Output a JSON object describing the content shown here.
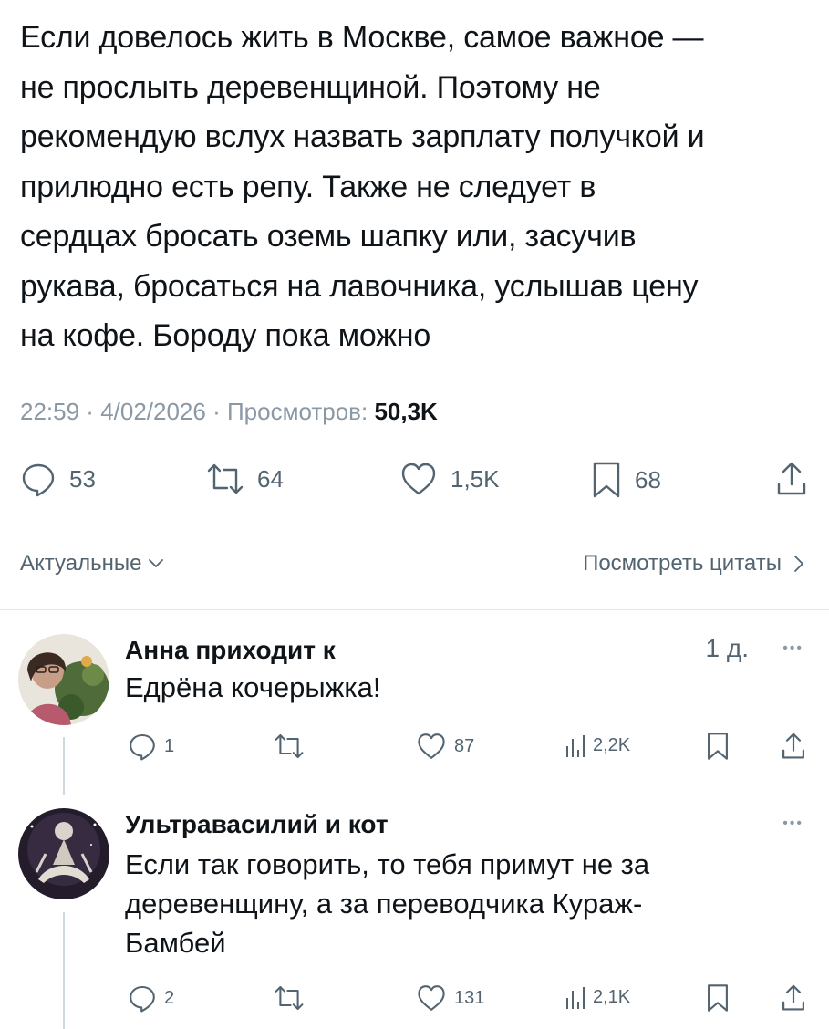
{
  "tweet": {
    "text_lines": [
      "Если довелось жить в Москве, самое важное —",
      "не прослыть деревенщиной. Поэтому не",
      "рекомендую вслух назвать зарплату получкой и",
      "прилюдно есть репу. Также не следует в",
      "сердцах бросать оземь шапку или, засучив",
      "рукава, бросаться на лавочника, услышав цену",
      "на кофе. Бороду пока можно"
    ],
    "time": "22:59",
    "date": "4/02/2026",
    "views_label": "Просмотров:",
    "views": "50,3K",
    "sep": " · ",
    "actions": {
      "replies": "53",
      "reposts": "64",
      "likes": "1,5K",
      "bookmarks": "68"
    }
  },
  "filters": {
    "sort_label": "Актуальные",
    "quotes_label": "Посмотреть цитаты"
  },
  "replies": [
    {
      "name": "Анна приходит к",
      "time": "1 д.",
      "more": "•••",
      "text_lines": [
        "Едрёна кочерыжка!"
      ],
      "replies": "1",
      "reposts": "",
      "likes": "87",
      "views": "2,2K"
    },
    {
      "name": "Ультравасилий и кот",
      "time": "",
      "more": "•••",
      "text_lines": [
        "Если так говорить, то тебя примут не за",
        "деревенщину, а за переводчика Кураж-",
        "Бамбей"
      ],
      "replies": "2",
      "reposts": "",
      "likes": "131",
      "views": "2,1K"
    }
  ],
  "colors": {
    "text": "#0f1419",
    "secondary": "#536471",
    "muted": "#8b98a5",
    "divider": "#e1e6ea"
  }
}
